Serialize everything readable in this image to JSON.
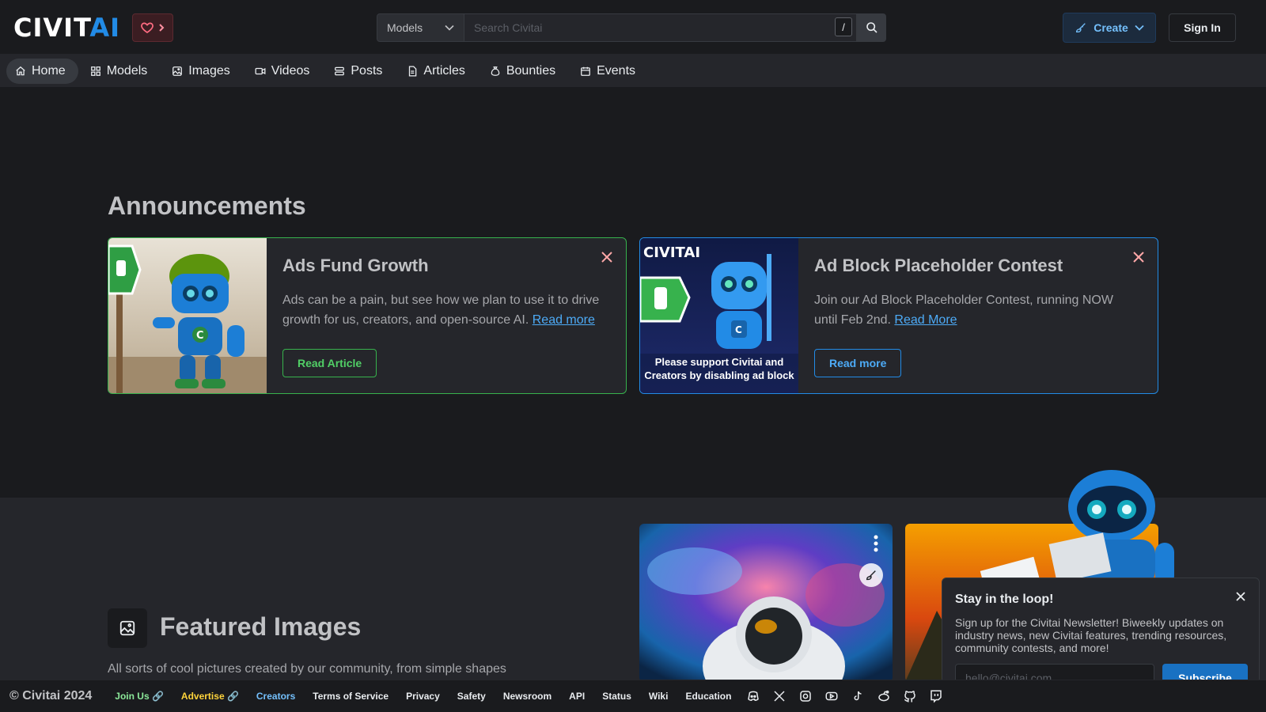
{
  "header": {
    "logo_main": "CIVIT",
    "logo_accent": "AI",
    "search": {
      "scope": "Models",
      "placeholder": "Search Civitai",
      "shortcut": "/"
    },
    "create_label": "Create",
    "signin_label": "Sign In"
  },
  "nav": {
    "items": [
      {
        "label": "Home",
        "icon": "home-icon",
        "active": true
      },
      {
        "label": "Models",
        "icon": "grid-icon"
      },
      {
        "label": "Images",
        "icon": "photo-icon"
      },
      {
        "label": "Videos",
        "icon": "video-icon"
      },
      {
        "label": "Posts",
        "icon": "stack-icon"
      },
      {
        "label": "Articles",
        "icon": "file-text-icon"
      },
      {
        "label": "Bounties",
        "icon": "moneybag-icon"
      },
      {
        "label": "Events",
        "icon": "calendar-icon"
      }
    ]
  },
  "announcements": {
    "title": "Announcements",
    "cards": [
      {
        "title": "Ads Fund Growth",
        "text": "Ads can be a pain, but see how we plan to use it to drive growth for us, creators, and open-source AI.",
        "link": "Read more",
        "button": "Read Article",
        "accent": "#37b24d"
      },
      {
        "title": "Ad Block Placeholder Contest",
        "text": "Join our Ad Block Placeholder Contest, running NOW until Feb 2nd.",
        "link": "Read More",
        "button": "Read more",
        "accent": "#228be6",
        "image_caption": "Please support Civitai and Creators by disabling ad block",
        "image_logo": "CIVITAI"
      }
    ]
  },
  "featured": {
    "title": "Featured Images",
    "description": "All sorts of cool pictures created by our community, from simple shapes"
  },
  "newsletter": {
    "title": "Stay in the loop!",
    "text": "Sign up for the Civitai Newsletter! Biweekly updates on industry news, new Civitai features, trending resources, community contests, and more!",
    "placeholder": "hello@civitai.com",
    "button": "Subscribe"
  },
  "footer": {
    "copyright": "© Civitai 2024",
    "links": [
      {
        "label": "Join Us 🔗",
        "style": "green"
      },
      {
        "label": "Advertise 🔗",
        "style": "yellow"
      },
      {
        "label": "Creators",
        "style": "blue"
      },
      {
        "label": "Terms of Service"
      },
      {
        "label": "Privacy"
      },
      {
        "label": "Safety"
      },
      {
        "label": "Newsroom"
      },
      {
        "label": "API"
      },
      {
        "label": "Status"
      },
      {
        "label": "Wiki"
      },
      {
        "label": "Education"
      }
    ],
    "social_icons": [
      "discord-icon",
      "x-icon",
      "instagram-icon",
      "youtube-icon",
      "tiktok-icon",
      "reddit-icon",
      "github-icon",
      "twitch-icon"
    ]
  },
  "colors": {
    "background": "#1a1b1e",
    "surface": "#25262b",
    "brand_blue": "#228be6",
    "green": "#37b24d"
  }
}
